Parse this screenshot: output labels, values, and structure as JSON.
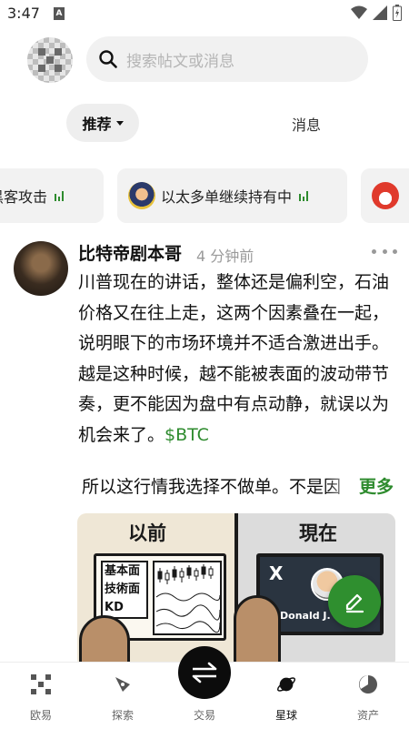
{
  "status_bar": {
    "time": "3:47",
    "badge": "A"
  },
  "header": {
    "search_placeholder": "搜索帖文或消息"
  },
  "tabs": {
    "recommend": "推荐",
    "messages": "消息"
  },
  "trending": [
    {
      "label": "元黑客攻击"
    },
    {
      "label": "以太多单继续持有中"
    },
    {
      "label": ""
    }
  ],
  "post": {
    "author": "比特帝剧本哥",
    "time": "4 分钟前",
    "body_text": "川普现在的讲话，整体还是偏利空，石油价格又在往上走，这两个因素叠在一起，说明眼下的市场环境并不适合激进出手。越是这种时候，越不能被表面的波动带节奏，更不能因为盘中有点动静，就误以为机会来了。",
    "cashtag": "$BTC",
    "second_paragraph": "所以这行情我选择不做单。不是因",
    "see_more": "更多",
    "image": {
      "left_title": "以前",
      "right_title": "現在",
      "left_labels": [
        "基本面",
        "技術面",
        "KD"
      ],
      "right_x": "X",
      "right_name": "Donald J."
    }
  },
  "bottom_nav": {
    "items": [
      {
        "label": "欧易",
        "icon": "okx-logo-icon"
      },
      {
        "label": "探索",
        "icon": "compass-icon"
      },
      {
        "label": "交易",
        "icon": "swap-arrows-icon"
      },
      {
        "label": "星球",
        "icon": "planet-icon"
      },
      {
        "label": "资产",
        "icon": "pie-chart-icon"
      }
    ],
    "active": "星球"
  },
  "colors": {
    "accent": "#2e8b2e",
    "fab": "#2f8f2f",
    "trade": "#0c0c0c"
  }
}
